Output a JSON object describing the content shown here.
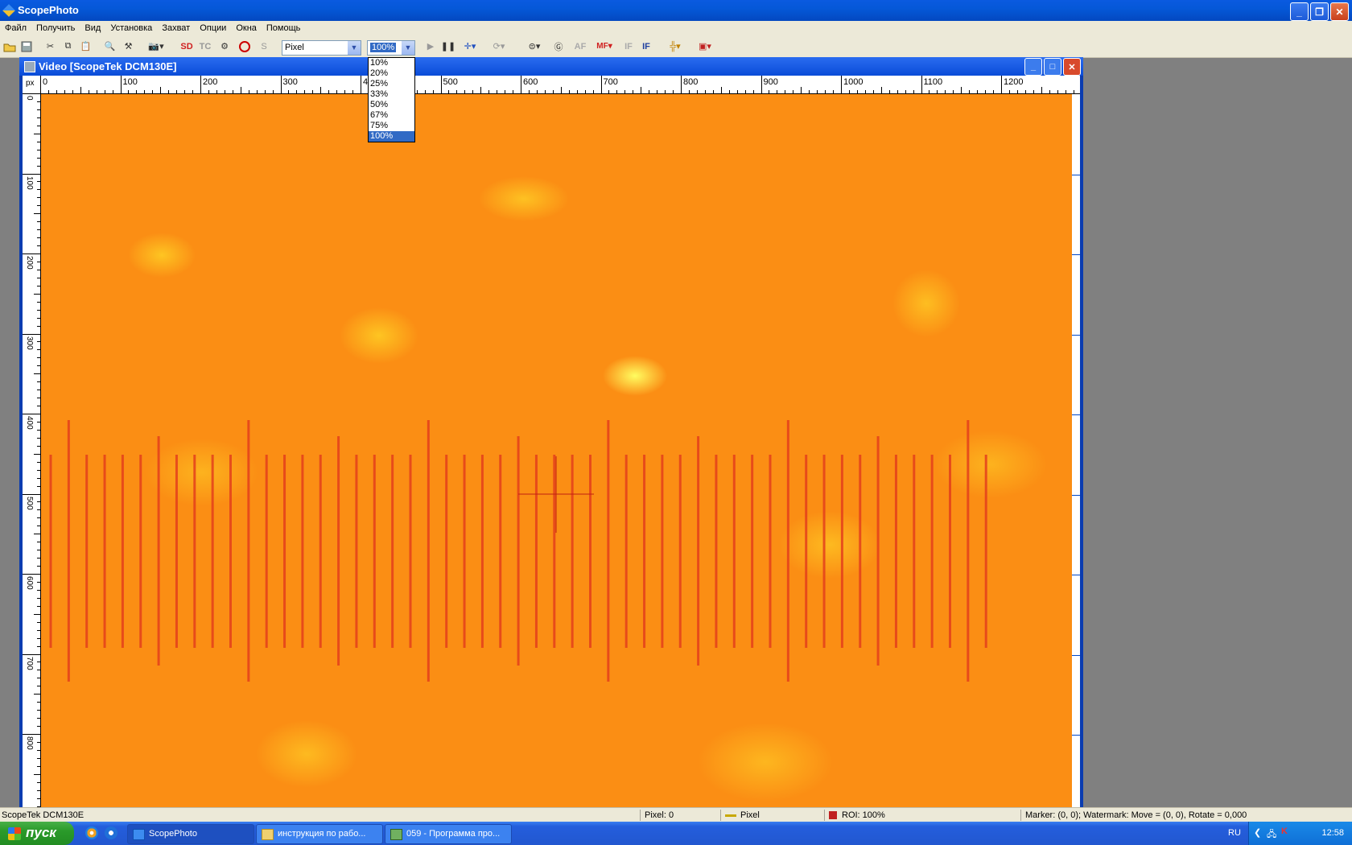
{
  "window": {
    "title": "ScopePhoto"
  },
  "menu": [
    "Файл",
    "Получить",
    "Вид",
    "Установка",
    "Захват",
    "Опции",
    "Окна",
    "Помощь"
  ],
  "toolbar": {
    "buttons": [
      "open-icon",
      "save-icon",
      "cut-icon",
      "copy-icon",
      "paste-icon",
      "zoom-icon",
      "tools-icon",
      "capture-icon"
    ],
    "sd_label": "SD",
    "tc_label": "TC",
    "s_label": "S",
    "af_label": "AF",
    "mf_label": "MF",
    "if1_label": "IF",
    "if2_label": "IF",
    "unit_select": "Pixel",
    "zoom_select": "100%"
  },
  "zoom_dropdown": {
    "options": [
      "10%",
      "20%",
      "25%",
      "33%",
      "50%",
      "67%",
      "75%",
      "100%"
    ],
    "selected": "100%"
  },
  "video_window": {
    "title": "Video [ScopeTek DCM130E]",
    "ruler_unit": "px",
    "h_ticks": [
      "0",
      "100",
      "200",
      "300",
      "400",
      "500",
      "600",
      "700",
      "800",
      "900",
      "1000",
      "1100",
      "1200"
    ],
    "v_ticks": [
      "0",
      "100",
      "200",
      "300",
      "400",
      "500",
      "600",
      "700",
      "800"
    ]
  },
  "statusbar": {
    "device": "ScopeTek DCM130E",
    "pixel": "Pixel: 0",
    "unit": "Pixel",
    "roi": "ROI: 100%",
    "marker": "Marker: (0, 0); Watermark: Move = (0, 0), Rotate = 0,000"
  },
  "taskbar": {
    "start": "пуск",
    "tasks": [
      "ScopePhoto",
      "инструкция по рабо...",
      "059 - Программа про..."
    ],
    "lang": "RU",
    "clock": "12:58"
  },
  "colors": {
    "image_base": "#fb8e14",
    "scale_lines": "#e4401c",
    "accent": "#316ac5"
  }
}
